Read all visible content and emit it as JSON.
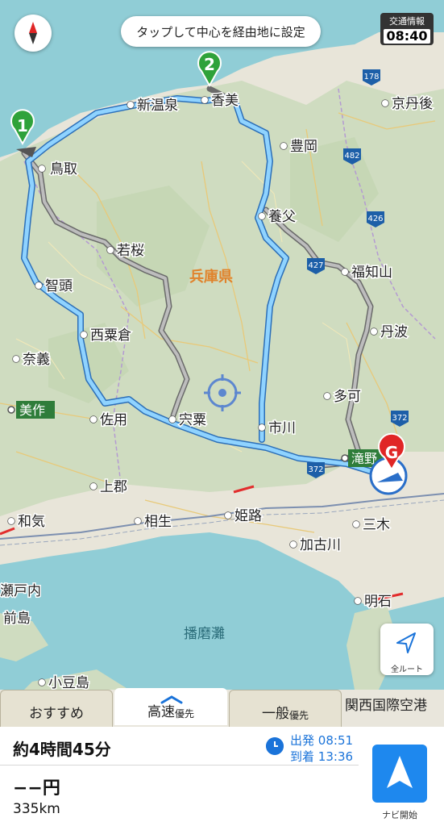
{
  "hint_pill": "タップして中心を経由地に設定",
  "traffic": {
    "label": "交通情報",
    "time": "08:40"
  },
  "prefecture": "兵庫県",
  "sea": "播磨灘",
  "cities": [
    {
      "id": "tottori",
      "name": "鳥取"
    },
    {
      "id": "shinonsen",
      "name": "新温泉"
    },
    {
      "id": "kami",
      "name": "香美"
    },
    {
      "id": "kyotango",
      "name": "京丹後"
    },
    {
      "id": "toyooka",
      "name": "豊岡"
    },
    {
      "id": "yabu",
      "name": "養父"
    },
    {
      "id": "wakasa",
      "name": "若桜"
    },
    {
      "id": "fukuchiyama",
      "name": "福知山"
    },
    {
      "id": "chizu",
      "name": "智頭"
    },
    {
      "id": "tamba",
      "name": "丹波"
    },
    {
      "id": "nishiawakura",
      "name": "西粟倉"
    },
    {
      "id": "nagi",
      "name": "奈義"
    },
    {
      "id": "taka",
      "name": "多可"
    },
    {
      "id": "mimasaka",
      "name": "美作"
    },
    {
      "id": "sayo",
      "name": "佐用"
    },
    {
      "id": "shiso",
      "name": "宍粟"
    },
    {
      "id": "ichikawa",
      "name": "市川"
    },
    {
      "id": "taki",
      "name": "滝野"
    },
    {
      "id": "kamigori",
      "name": "上郡"
    },
    {
      "id": "wake",
      "name": "和気"
    },
    {
      "id": "aioi",
      "name": "相生"
    },
    {
      "id": "himeji",
      "name": "姫路"
    },
    {
      "id": "miki",
      "name": "三木"
    },
    {
      "id": "kakogawa",
      "name": "加古川"
    },
    {
      "id": "setouchi",
      "name": "瀬戸内"
    },
    {
      "id": "ushimado",
      "name": "前島"
    },
    {
      "id": "akashi",
      "name": "明石"
    },
    {
      "id": "shodoshima",
      "name": "小豆島"
    }
  ],
  "road_numbers": [
    "178",
    "482",
    "426",
    "427",
    "372",
    "372"
  ],
  "waypoints": [
    "1",
    "2"
  ],
  "goal": "G",
  "all_route_label": "全ルート",
  "tabs": [
    {
      "label": "おすすめ",
      "small": ""
    },
    {
      "label": "高速",
      "small": "優先"
    },
    {
      "label": "一般",
      "small": "優先"
    }
  ],
  "kansai_airport": "関西国際空港",
  "summary": {
    "duration": "約4時間45分",
    "toll": "−−円",
    "distance": "335km",
    "depart_label": "出発",
    "depart_time": "08:51",
    "arrive_label": "到着",
    "arrive_time": "13:36"
  },
  "nav_start": "ナビ開始"
}
